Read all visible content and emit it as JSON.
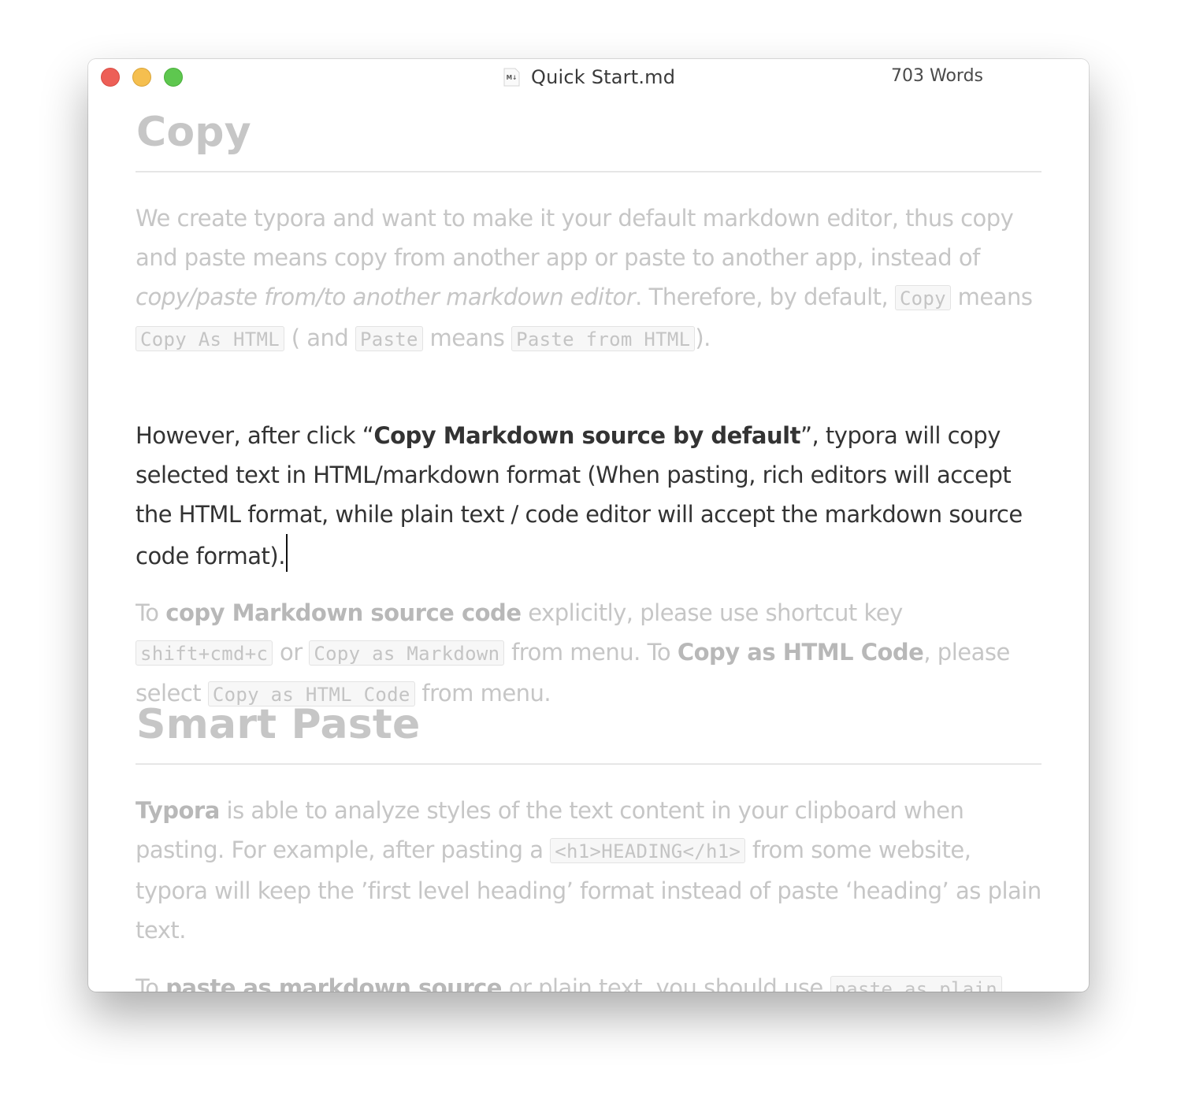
{
  "window": {
    "title": "Quick Start.md",
    "word_count": "703 Words",
    "doc_icon_text": "M↓"
  },
  "document": {
    "heading1": "Copy",
    "p1": {
      "t1": "We create typora and want to make it your default markdown editor, thus copy and paste means copy from another app or paste to another app, instead of ",
      "em": "copy/paste from/to another markdown editor",
      "t2": ". Therefore, by default, ",
      "code1": "Copy",
      "t3": " means ",
      "code2": "Copy As HTML",
      "t4": " ( and ",
      "code3": "Paste",
      "t5": " means ",
      "code4": "Paste from HTML",
      "t6": ")."
    },
    "p2": {
      "t1": "However, after click “",
      "b1": "Copy Markdown source by default",
      "t2": "”, typora will copy selected text in HTML/markdown format (When pasting, rich editors will accept the HTML format, while plain text / code editor will accept the markdown source code format)."
    },
    "p3": {
      "t1": "To ",
      "b1": "copy Markdown source code",
      "t2": " explicitly, please use shortcut key ",
      "code1": "shift+cmd+c",
      "t3": " or ",
      "code2": "Copy as Markdown",
      "t4": " from menu. To ",
      "b2": "Copy as HTML Code",
      "t5": ", please select ",
      "code3": "Copy as HTML Code",
      "t6": " from menu."
    },
    "heading2": "Smart Paste",
    "p4": {
      "b1": "Typora",
      "t1": " is able to analyze styles of the text content in your clipboard when pasting. For example, after pasting a ",
      "code1": "<h1>HEADING</h1>",
      "t2": " from some website, typora will keep the ’first level heading’ format instead of paste ‘heading’ as plain text."
    },
    "p5": {
      "t1": "To ",
      "b1": "paste as markdown source",
      "t2": " or plain text, you should use ",
      "code1": "paste as plain"
    }
  }
}
